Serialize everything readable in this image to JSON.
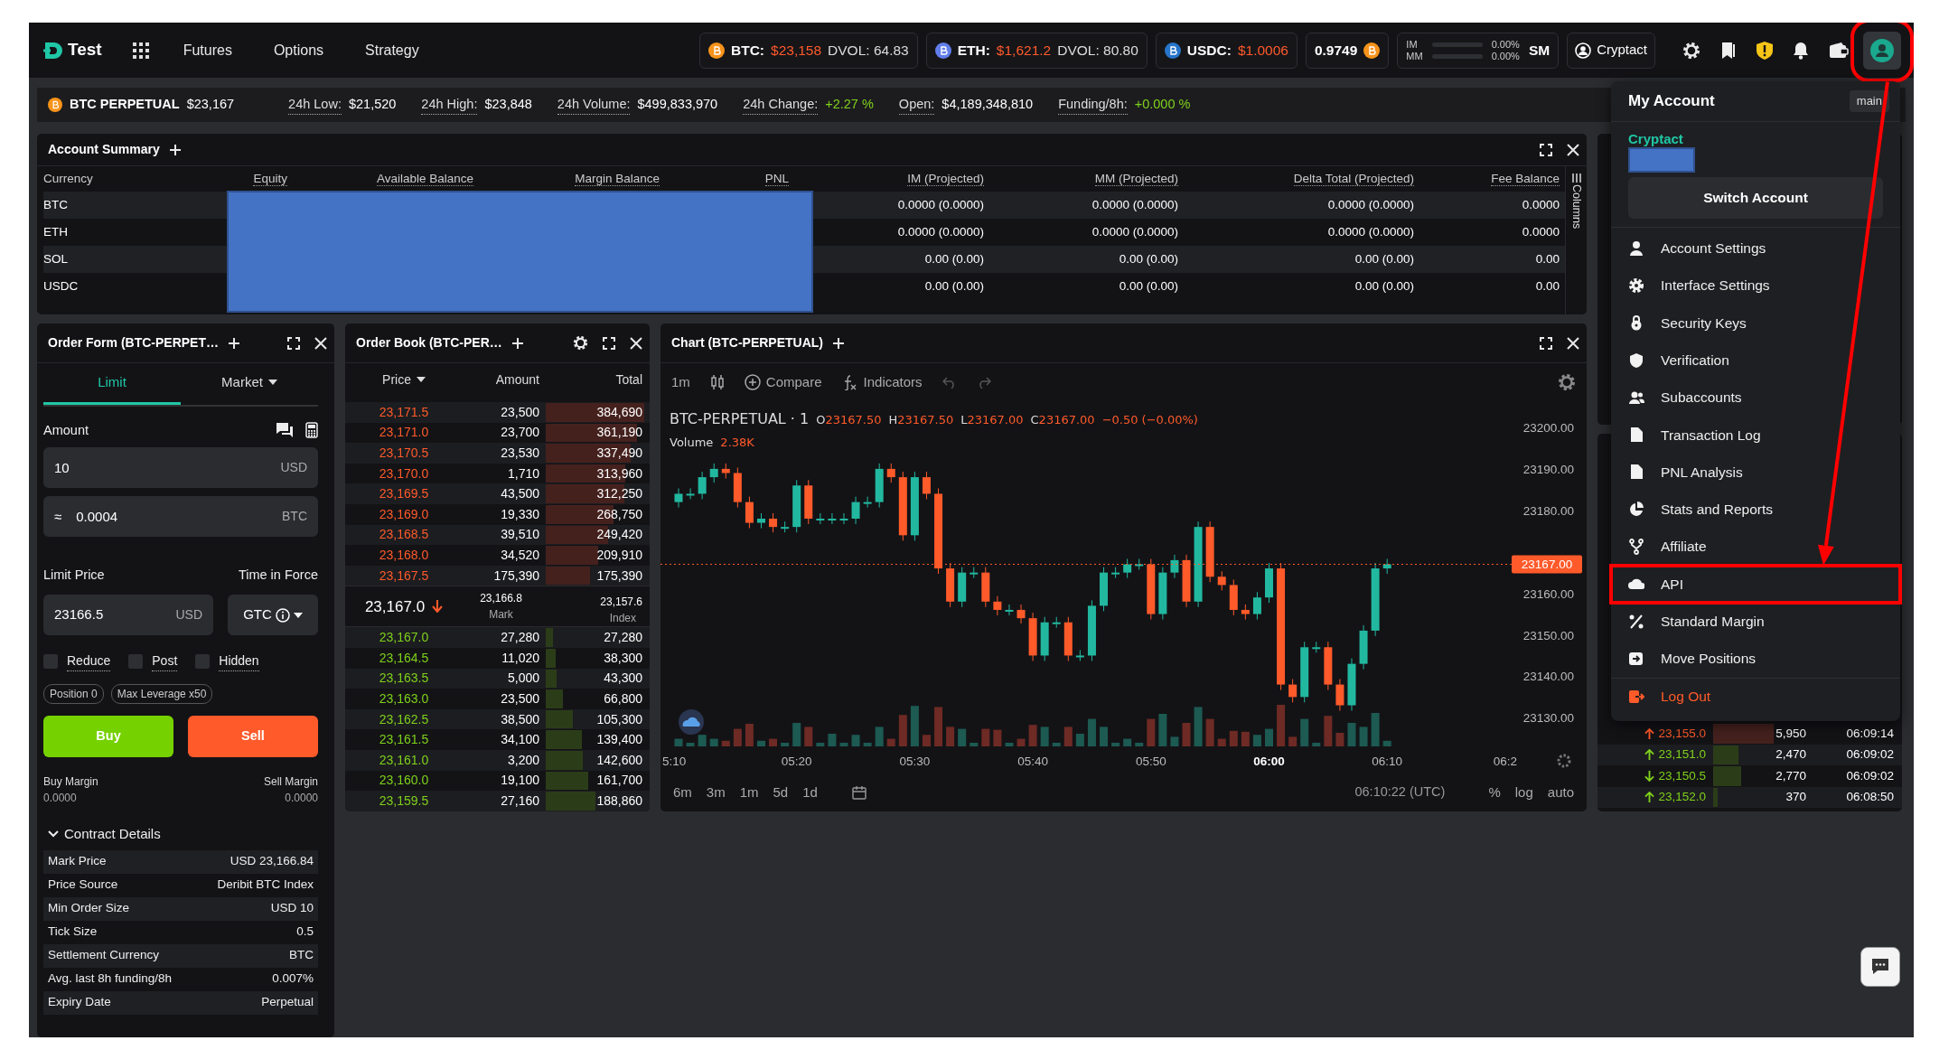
{
  "nav": {
    "brand": "Test",
    "links": [
      "Futures",
      "Options",
      "Strategy"
    ],
    "tickers": [
      {
        "symbol": "BTC:",
        "price": "$23,158",
        "dvol": "DVOL: 64.83",
        "color": "#f7931a"
      },
      {
        "symbol": "ETH:",
        "price": "$1,621.2",
        "dvol": "DVOL: 80.80",
        "color": "#627eea"
      },
      {
        "symbol": "USDC:",
        "price": "$1.0006",
        "color": "#2775ca"
      }
    ],
    "ratio": "0.9749",
    "margins": [
      {
        "label": "IM",
        "value": "0.00%",
        "level": 0
      },
      {
        "label": "MM",
        "value": "0.00%",
        "level": 0
      }
    ],
    "margin_mode": "SM",
    "account": "Cryptact",
    "avatar_annotated": true
  },
  "ticker_bar": {
    "instrument": "BTC PERPETUAL",
    "price": "$23,167",
    "stats": [
      {
        "label": "24h Low:",
        "value": "$21,520",
        "positive": false
      },
      {
        "label": "24h High:",
        "value": "$23,848",
        "positive": false
      },
      {
        "label": "24h Volume:",
        "value": "$499,833,970",
        "positive": false
      },
      {
        "label": "24h Change:",
        "value": "+2.27 %",
        "positive": true
      },
      {
        "label": "Open:",
        "value": "$4,189,348,810",
        "positive": false
      },
      {
        "label": "Funding/8h:",
        "value": "+0.000 %",
        "positive": true
      }
    ]
  },
  "account_summary": {
    "title": "Account Summary",
    "columns": [
      "Currency",
      "Equity",
      "Available Balance",
      "Margin Balance",
      "PNL",
      "IM (Projected)",
      "MM (Projected)",
      "Delta Total (Projected)",
      "Fee Balance"
    ],
    "rows": [
      {
        "currency": "BTC",
        "values": [
          "0.0000 (0.0000)",
          "0.0000 (0.0000)",
          "0.0000 (0.0000)",
          "0.0000"
        ]
      },
      {
        "currency": "ETH",
        "values": [
          "0.0000 (0.0000)",
          "0.0000 (0.0000)",
          "0.0000 (0.0000)",
          "0.0000"
        ]
      },
      {
        "currency": "SOL",
        "values": [
          "0.00 (0.00)",
          "0.00 (0.00)",
          "0.00 (0.00)",
          "0.00"
        ]
      },
      {
        "currency": "USDC",
        "values": [
          "0.00 (0.00)",
          "0.00 (0.00)",
          "0.00 (0.00)",
          "0.00"
        ]
      }
    ],
    "columns_toggle": "Columns",
    "redacted": true
  },
  "order_form": {
    "title": "Order Form (BTC-PERPET…",
    "tabs": [
      {
        "label": "Limit",
        "selected": true,
        "dropdown": false
      },
      {
        "label": "Market",
        "selected": false,
        "dropdown": true
      }
    ],
    "amount_label": "Amount",
    "amount": {
      "value": "10",
      "unit": "USD"
    },
    "converted": {
      "prefix": "≈",
      "value": "0.0004",
      "unit": "BTC"
    },
    "limit_label": "Limit Price",
    "tif_label": "Time in Force",
    "limit": {
      "value": "23166.5",
      "unit": "USD"
    },
    "tif": "GTC",
    "options": [
      {
        "label": "Reduce",
        "checked": false
      },
      {
        "label": "Post",
        "checked": false
      },
      {
        "label": "Hidden",
        "checked": false
      }
    ],
    "tags": [
      "Position 0",
      "Max Leverage x50"
    ],
    "buy": "Buy",
    "sell": "Sell",
    "margins": [
      {
        "label": "Buy Margin",
        "value": "0.0000"
      },
      {
        "label": "Sell Margin",
        "value": "0.0000"
      }
    ],
    "details": {
      "title": "Contract Details",
      "expanded": true,
      "rows": [
        {
          "label": "Mark Price",
          "value": "USD 23,166.84"
        },
        {
          "label": "Price Source",
          "value": "Deribit BTC Index"
        },
        {
          "label": "Min Order Size",
          "value": "USD 10"
        },
        {
          "label": "Tick Size",
          "value": "0.5"
        },
        {
          "label": "Settlement Currency",
          "value": "BTC"
        },
        {
          "label": "Avg. last 8h funding/8h",
          "value": "0.007%"
        },
        {
          "label": "Expiry Date",
          "value": "Perpetual"
        }
      ]
    }
  },
  "order_book": {
    "title": "Order Book (BTC-PER…",
    "columns": [
      "Price",
      "Amount",
      "Total"
    ],
    "asks": [
      {
        "price": "23,171.5",
        "amount": "23,500",
        "total": "384,690"
      },
      {
        "price": "23,171.0",
        "amount": "23,700",
        "total": "361,190"
      },
      {
        "price": "23,170.5",
        "amount": "23,530",
        "total": "337,490"
      },
      {
        "price": "23,170.0",
        "amount": "1,710",
        "total": "313,960"
      },
      {
        "price": "23,169.5",
        "amount": "43,500",
        "total": "312,250"
      },
      {
        "price": "23,169.0",
        "amount": "19,330",
        "total": "268,750"
      },
      {
        "price": "23,168.5",
        "amount": "39,510",
        "total": "249,420"
      },
      {
        "price": "23,168.0",
        "amount": "34,520",
        "total": "209,910"
      },
      {
        "price": "23,167.5",
        "amount": "175,390",
        "total": "175,390"
      }
    ],
    "last": {
      "price": "23,167.0",
      "falling": true,
      "mark": "23,166.8",
      "mark_label": "Mark",
      "index": "23,157.6",
      "index_label": "Index"
    },
    "bids": [
      {
        "price": "23,167.0",
        "amount": "27,280",
        "total": "27,280"
      },
      {
        "price": "23,164.5",
        "amount": "11,020",
        "total": "38,300"
      },
      {
        "price": "23,163.5",
        "amount": "5,000",
        "total": "43,300"
      },
      {
        "price": "23,163.0",
        "amount": "23,500",
        "total": "66,800"
      },
      {
        "price": "23,162.5",
        "amount": "38,500",
        "total": "105,300"
      },
      {
        "price": "23,161.5",
        "amount": "34,100",
        "total": "139,400"
      },
      {
        "price": "23,161.0",
        "amount": "3,200",
        "total": "142,600"
      },
      {
        "price": "23,160.0",
        "amount": "19,100",
        "total": "161,700"
      },
      {
        "price": "23,159.5",
        "amount": "27,160",
        "total": "188,860"
      }
    ]
  },
  "chart": {
    "title": "Chart (BTC-PERPETUAL)",
    "interval": "1m",
    "compare": "Compare",
    "indicators": "Indicators",
    "symbol": "BTC-PERPETUAL · 1",
    "ohlc": [
      {
        "key": "O",
        "value": "23167.50"
      },
      {
        "key": "H",
        "value": "23167.50"
      },
      {
        "key": "L",
        "value": "23167.00"
      },
      {
        "key": "C",
        "value": "23167.00"
      }
    ],
    "change": "−0.50 (−0.00%)",
    "volume_label": "Volume",
    "volume": "2.38K",
    "y_labels": [
      "23200.00",
      "23190.00",
      "23180.00",
      "23160.00",
      "23150.00",
      "23140.00",
      "23130.00"
    ],
    "price_tag": "23167.00",
    "x_labels": [
      {
        "label": "5:10",
        "bold": false
      },
      {
        "label": "05:20",
        "bold": false
      },
      {
        "label": "05:30",
        "bold": false
      },
      {
        "label": "05:40",
        "bold": false
      },
      {
        "label": "05:50",
        "bold": false
      },
      {
        "label": "06:00",
        "bold": true
      },
      {
        "label": "06:10",
        "bold": false
      },
      {
        "label": "06:2",
        "bold": false
      }
    ],
    "ranges": [
      "6m",
      "3m",
      "1m",
      "5d",
      "1d"
    ],
    "clock": "06:10:22 (UTC)",
    "scale_options": [
      "%",
      "log",
      "auto"
    ]
  },
  "trades": {
    "rows": [
      {
        "rising": true,
        "sell": true,
        "price": "23,155.0",
        "amount": "5,950",
        "time": "06:09:14"
      },
      {
        "rising": true,
        "sell": false,
        "price": "23,151.0",
        "amount": "2,470",
        "time": "06:09:02"
      },
      {
        "rising": false,
        "sell": false,
        "price": "23,150.5",
        "amount": "2,770",
        "time": "06:09:02"
      },
      {
        "rising": true,
        "sell": false,
        "price": "23,152.0",
        "amount": "370",
        "time": "06:08:50"
      }
    ]
  },
  "account_menu": {
    "title": "My Account",
    "badge": "main",
    "account_name": "Cryptact",
    "redacted": true,
    "switch": "Switch Account",
    "items": [
      {
        "label": "Account Settings",
        "annotated": false
      },
      {
        "label": "Interface Settings",
        "annotated": false
      },
      {
        "label": "Security Keys",
        "annotated": false
      },
      {
        "label": "Verification",
        "annotated": false
      },
      {
        "label": "Subaccounts",
        "annotated": false
      },
      {
        "label": "Transaction Log",
        "annotated": false
      },
      {
        "label": "PNL Analysis",
        "annotated": false
      },
      {
        "label": "Stats and Reports",
        "annotated": false
      },
      {
        "label": "Affiliate",
        "annotated": false
      },
      {
        "label": "API",
        "annotated": true
      },
      {
        "label": "Standard Margin",
        "annotated": false
      },
      {
        "label": "Move Positions",
        "annotated": false
      }
    ],
    "logout": "Log Out"
  }
}
